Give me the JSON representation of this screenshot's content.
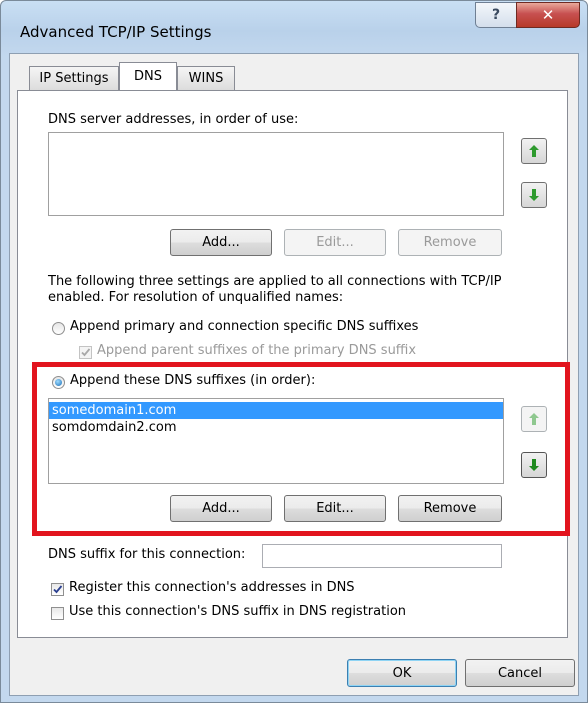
{
  "window": {
    "title": "Advanced TCP/IP Settings"
  },
  "tabs": [
    {
      "label": "IP Settings"
    },
    {
      "label": "DNS"
    },
    {
      "label": "WINS"
    }
  ],
  "dns_servers": {
    "label": "DNS server addresses, in order of use:",
    "items": [],
    "add_label": "Add...",
    "edit_label": "Edit...",
    "remove_label": "Remove"
  },
  "description": {
    "line1": "The following three settings are applied to all connections with TCP/IP",
    "line2": "enabled. For resolution of unqualified names:"
  },
  "radio_primary": {
    "label": "Append primary and connection specific DNS suffixes",
    "checked": false
  },
  "check_parent": {
    "label": "Append parent suffixes of the primary DNS suffix",
    "checked": true,
    "enabled": false
  },
  "radio_these": {
    "label": "Append these DNS suffixes (in order):",
    "checked": true
  },
  "dns_suffixes": {
    "items": [
      "somedomain1.com",
      "somdomdain2.com"
    ],
    "selected_index": 0,
    "add_label": "Add...",
    "edit_label": "Edit...",
    "remove_label": "Remove"
  },
  "connection_suffix": {
    "label": "DNS suffix for this connection:",
    "value": ""
  },
  "check_register": {
    "label": "Register this connection's addresses in DNS",
    "checked": true
  },
  "check_use_suffix": {
    "label": "Use this connection's DNS suffix in DNS registration",
    "checked": false
  },
  "buttons": {
    "ok": "OK",
    "cancel": "Cancel"
  },
  "colors": {
    "highlight": "#e2141e",
    "selection": "#3399ff",
    "arrow_green": "#2e9a2e"
  }
}
